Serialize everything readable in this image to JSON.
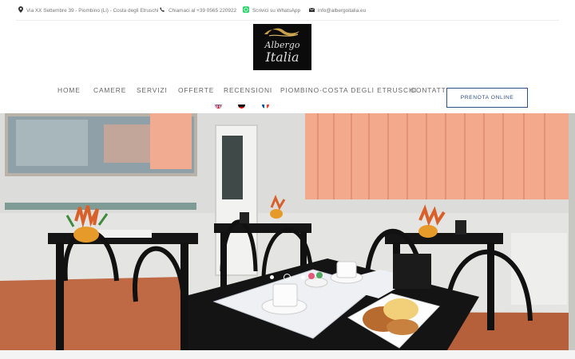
{
  "topbar": {
    "address": "Via XX Settembre 39 - Piombino (Li) - Costa degli Etruschi",
    "phone": "Chiamaci al +39 0565 220922",
    "whatsapp": "Scrivici su WhatsApp",
    "email": "info@albergoitalia.eu"
  },
  "logo": {
    "line1": "Albergo",
    "line2": "Italia"
  },
  "nav": {
    "items": [
      "HOME",
      "CAMERE",
      "SERVIZI",
      "OFFERTE",
      "RECENSIONI",
      "PIOMBINO-COSTA DEGLI ETRUSCHI",
      "CONTATTI"
    ],
    "book_label": "PRENOTA ONLINE"
  },
  "languages": [
    "english-flag",
    "german-flag",
    "french-flag"
  ],
  "slider": {
    "slide_count": 3,
    "active_index": 1
  },
  "colors": {
    "accent": "#2e4f8b",
    "whatsapp": "#25d366",
    "curtain": "#f2a98c"
  }
}
